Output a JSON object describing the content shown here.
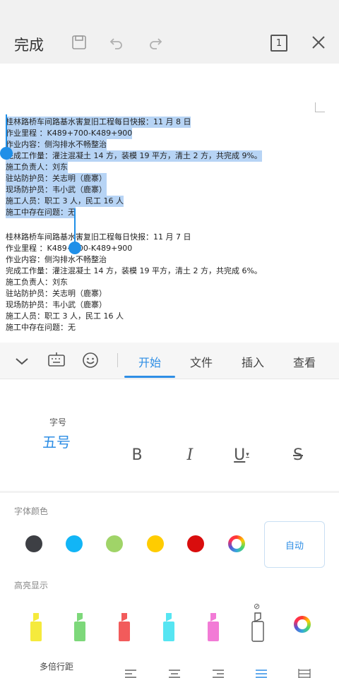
{
  "toolbar": {
    "done_label": "完成",
    "page_count": "1",
    "icons": [
      "save-icon",
      "undo-icon",
      "redo-icon",
      "page-count-icon",
      "close-icon"
    ]
  },
  "document": {
    "paragraphs": [
      {
        "selected": true,
        "lines": [
          "桂林路桥车间路基水害复旧工程每日快报：11 月 8 日",
          "作业里程 ：K489+700-K489+900",
          "作业内容：侧沟排水不畅整治",
          "完成工作量：灌注混凝土 14 方，装模 19 平方，清土 2 方，共完成 9%。",
          "施工负责人：刘东",
          "驻站防护员：关志明（鹿寨）",
          "现场防护员：韦小武（鹿寨）",
          "施工人员：职工 3 人，民工 16 人",
          "施工中存在问题：无"
        ]
      },
      {
        "selected": false,
        "lines": [
          "桂林路桥车间路基水害复旧工程每日快报：11 月 7 日",
          "作业里程 ：K489+700-K489+900",
          "作业内容：侧沟排水不畅整治",
          "完成工作量：灌注混凝土 14 方，装模 19 平方，清土 2 方，共完成 6%。",
          "施工负责人：刘东",
          "驻站防护员：关志明（鹿寨）",
          "现场防护员：韦小武（鹿寨）",
          "施工人员：职工 3 人，民工 16 人",
          "施工中存在问题：无"
        ]
      }
    ]
  },
  "tabs": {
    "items": [
      "开始",
      "文件",
      "插入",
      "查看"
    ],
    "active": "开始",
    "icons": [
      "collapse-chevron-icon",
      "keyboard-icon",
      "emoji-icon"
    ]
  },
  "font_panel": {
    "size_label": "字号",
    "size_value": "五号",
    "format_buttons": [
      "B",
      "I",
      "U",
      "S"
    ]
  },
  "font_color": {
    "title": "字体颜色",
    "colors": [
      "#3d3f44",
      "#12b5f6",
      "#a0d468",
      "#ffcc00",
      "#d90d0d"
    ],
    "auto_label": "自动"
  },
  "highlight": {
    "title": "高亮显示",
    "colors": [
      "#f5ea3c",
      "#7dd87a",
      "#f25b5b",
      "#56e5f2",
      "#f27bd6"
    ],
    "none_symbol": "⊘"
  },
  "line_spacing": {
    "label": "多倍行距"
  }
}
